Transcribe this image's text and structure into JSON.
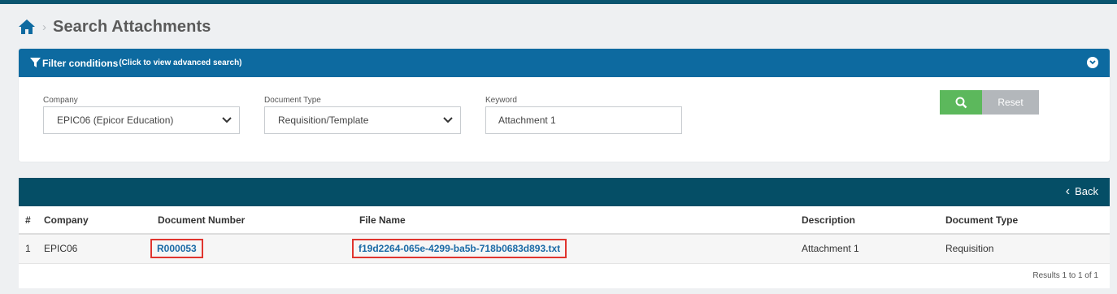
{
  "breadcrumb": {
    "title": "Search Attachments"
  },
  "filter": {
    "title": "Filter conditions",
    "hint": "(Click to view advanced search)",
    "company": {
      "label": "Company",
      "value": "EPIC06 (Epicor Education)"
    },
    "document_type": {
      "label": "Document Type",
      "value": "Requisition/Template"
    },
    "keyword": {
      "label": "Keyword",
      "value": "Attachment 1"
    },
    "reset_label": "Reset"
  },
  "results": {
    "back_label": "Back",
    "columns": [
      "#",
      "Company",
      "Document Number",
      "File Name",
      "Description",
      "Document Type"
    ],
    "rows": [
      {
        "index": "1",
        "company": "EPIC06",
        "document_number": "R000053",
        "file_name": "f19d2264-065e-4299-ba5b-718b0683d893.txt",
        "description": "Attachment 1",
        "document_type": "Requisition"
      }
    ],
    "count_text": "Results 1 to 1 of 1"
  },
  "colors": {
    "header_blue": "#0d6aa0",
    "results_header": "#054e66",
    "search_green": "#5cb85c",
    "reset_gray": "#b3b7bb",
    "link_blue": "#1a6aa6",
    "highlight_red": "#e0352f"
  },
  "icons": [
    "home-icon",
    "chevron-right-icon",
    "filter-icon",
    "chevron-down-circle-icon",
    "chevron-down-icon",
    "search-icon",
    "chevron-left-icon"
  ]
}
